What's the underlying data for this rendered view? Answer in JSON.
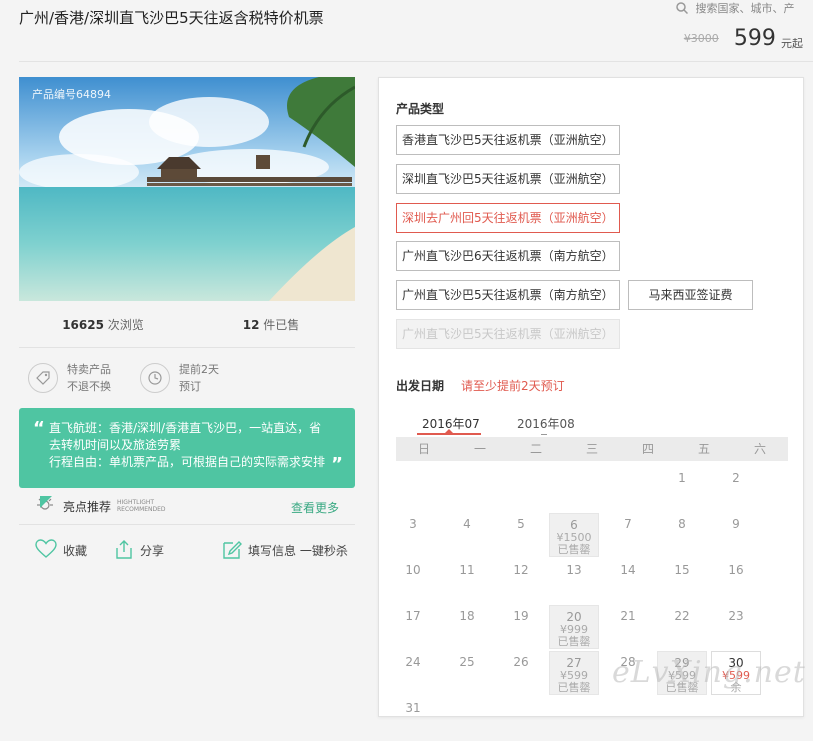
{
  "header": {
    "title": "广州/香港/深圳直飞沙巴5天往返含税特价机票",
    "search_placeholder": "搜索国家、城市、产",
    "old_price": "¥3000",
    "price": "599",
    "price_unit": "元起"
  },
  "product": {
    "code_label": "产品编号64894",
    "views": "16625",
    "views_label": "次浏览",
    "sold": "12",
    "sold_label": "件已售",
    "badge1_line1": "特卖产品",
    "badge1_line2": "不退不换",
    "badge2_line1": "提前2天",
    "badge2_line2": "预订",
    "quote_open": "“",
    "quote_close": "”",
    "highlight_lines": [
      "直飞航班：香港/深圳/香港直飞沙巴，一站直达，省",
      "去转机时间以及旅途劳累",
      "行程自由：单机票产品，可根据自己的实际需求安排"
    ],
    "highlight_label": "亮点推荐",
    "highlight_en_1": "HIGHTLIGHT",
    "highlight_en_2": "RECOMMENDED",
    "see_more": "查看更多",
    "favorite": "收藏",
    "share": "分享",
    "fill_info": "填写信息 一键秒杀"
  },
  "types": {
    "label": "产品类型",
    "options": [
      "香港直飞沙巴5天往返机票（亚洲航空）",
      "深圳直飞沙巴5天往返机票（亚洲航空）",
      "深圳去广州回5天往返机票（亚洲航空）",
      "广州直飞沙巴6天往返机票（南方航空）",
      "广州直飞沙巴5天往返机票（南方航空）",
      "广州直飞沙巴5天往返机票（亚洲航空）"
    ],
    "selected_index": 2,
    "disabled_index": 5,
    "visa": "马来西亚签证费"
  },
  "calendar": {
    "label": "出发日期",
    "note": "请至少提前2天预订",
    "months": [
      "2016年07",
      "2016年08"
    ],
    "active_month": "2016年07",
    "weekdays": [
      "日",
      "一",
      "二",
      "三",
      "四",
      "五",
      "六"
    ],
    "days": [
      {
        "d": "1"
      },
      {
        "d": "2"
      },
      {
        "d": "3"
      },
      {
        "d": "4"
      },
      {
        "d": "5"
      },
      {
        "d": "6",
        "price": "¥1500",
        "status": "已售罄"
      },
      {
        "d": "7"
      },
      {
        "d": "8"
      },
      {
        "d": "9"
      },
      {
        "d": "10"
      },
      {
        "d": "11"
      },
      {
        "d": "12"
      },
      {
        "d": "13"
      },
      {
        "d": "14"
      },
      {
        "d": "15"
      },
      {
        "d": "16"
      },
      {
        "d": "17"
      },
      {
        "d": "18"
      },
      {
        "d": "19"
      },
      {
        "d": "20",
        "price": "¥999",
        "status": "已售罄"
      },
      {
        "d": "21"
      },
      {
        "d": "22"
      },
      {
        "d": "23"
      },
      {
        "d": "24"
      },
      {
        "d": "25"
      },
      {
        "d": "26"
      },
      {
        "d": "27",
        "price": "¥599",
        "status": "已售罄"
      },
      {
        "d": "28"
      },
      {
        "d": "29",
        "price": "¥599",
        "status": "已售罄"
      },
      {
        "d": "30",
        "price": "¥599",
        "status": "余"
      },
      {
        "d": "31"
      }
    ]
  },
  "watermark": "eLvXing.net"
}
